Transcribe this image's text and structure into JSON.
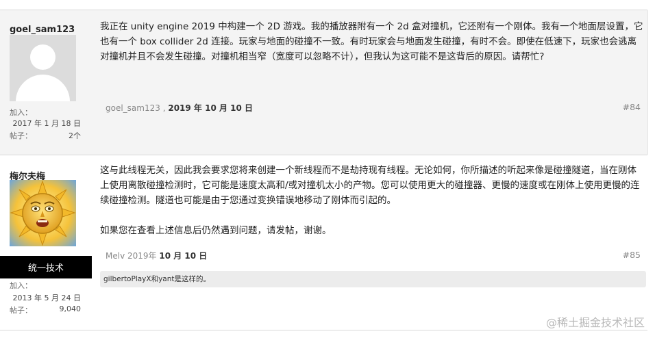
{
  "posts": [
    {
      "author": {
        "username": "goel_sam123",
        "avatar": "default-avatar-icon",
        "joined_label": "加入：",
        "joined_value": "2017 年 1 月 18 日",
        "posts_label": "帖子：",
        "posts_value": "2个"
      },
      "body": [
        "我正在 unity engine 2019 中构建一个 2D 游戏。我的播放器附有一个 2d 盒对撞机，它还附有一个刚体。我有一个地面层设置，它也有一个 box collider 2d 连接。玩家与地面的碰撞不一致。有时玩家会与地面发生碰撞，有时不会。即使在低速下，玩家也会逃离对撞机并且不会发生碰撞。对撞机相当窄（宽度可以忽略不计），但我认为这可能不是这背后的原因。请帮忙?"
      ],
      "footer_author": "goel_sam123 ,",
      "footer_date": "2019 年 10 月 10 日",
      "post_number": "#84"
    },
    {
      "author": {
        "username": "梅尔夫梅",
        "avatar": "sun-face-avatar",
        "rank": "统一技术",
        "joined_label": "加入：",
        "joined_value": "2013 年 5 月 24 日",
        "posts_label": "帖子：",
        "posts_value": "9,040"
      },
      "body": [
        "这与此线程无关，因此我会要求您将来创建一个新线程而不是劫持现有线程。无论如何，你所描述的听起来像是碰撞隧道，当在刚体上使用离散碰撞检测时，它可能是速度太高和/或对撞机太小的产物。您可以使用更大的碰撞器、更慢的速度或在刚体上使用更慢的连续碰撞检测。隧道也可能是由于您通过变换错误地移动了刚体而引起的。",
        "如果您在查看上述信息后仍然遇到问题，请发帖，谢谢。"
      ],
      "footer_author": "Melv 2019年",
      "footer_date": "10 月 10 日",
      "post_number": "#85",
      "reaction": "gilbertoPlayX和yant是这样的。"
    }
  ],
  "watermark": "@稀土掘金技术社区"
}
